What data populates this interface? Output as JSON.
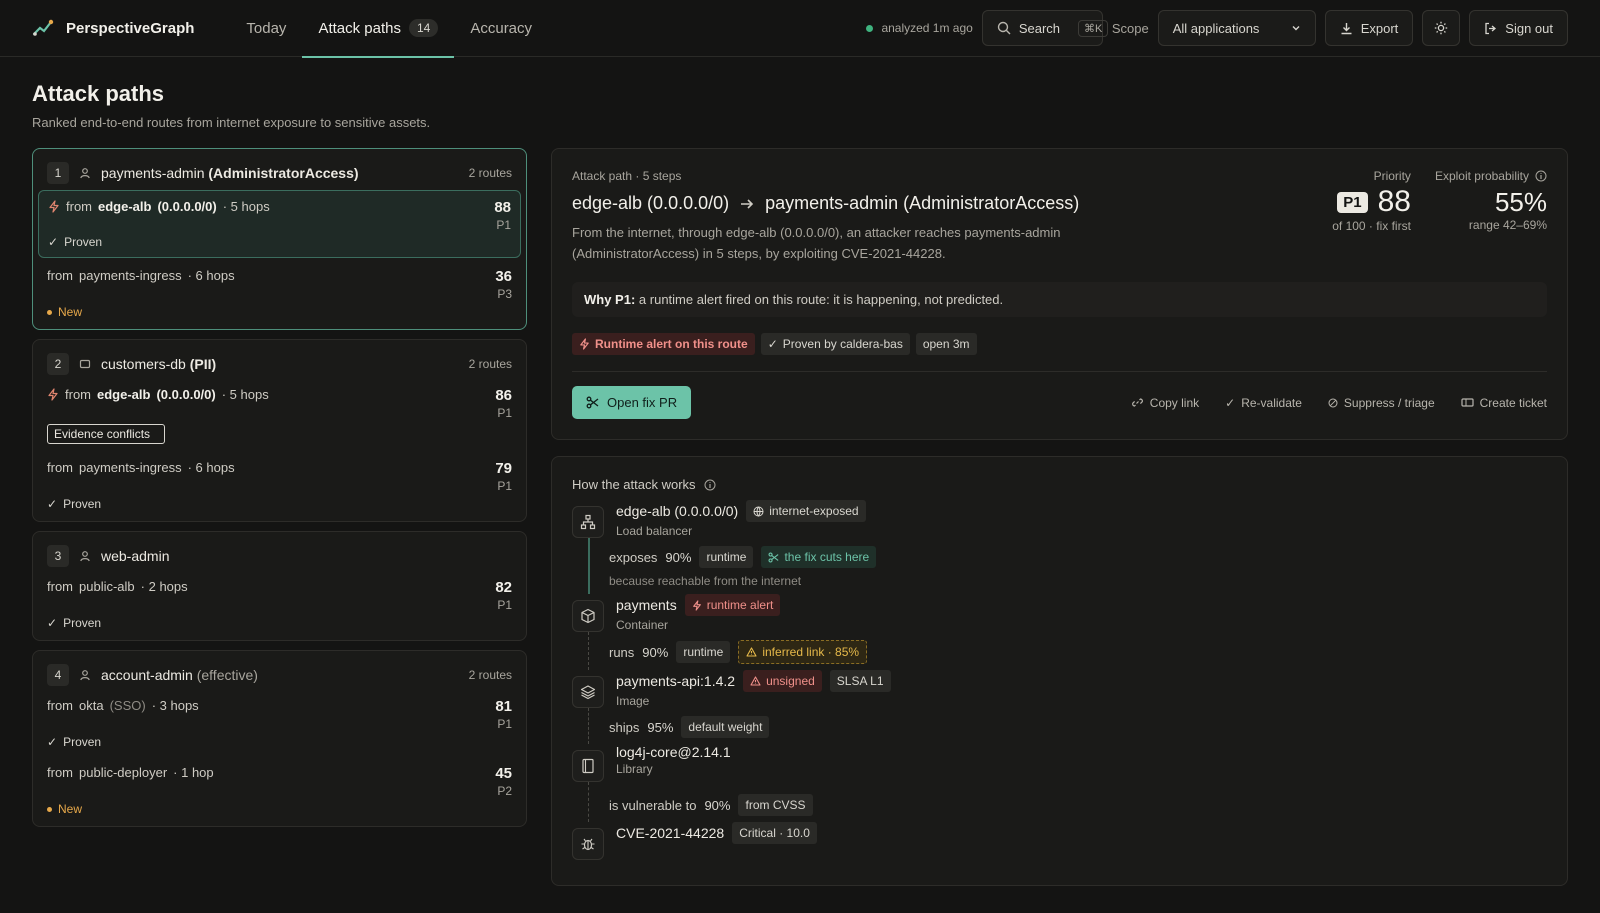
{
  "app": {
    "name": "PerspectiveGraph"
  },
  "nav": [
    {
      "label": "Today"
    },
    {
      "label": "Attack paths",
      "badge": "14"
    },
    {
      "label": "Accuracy"
    }
  ],
  "header": {
    "status": "analyzed 1m ago",
    "search_label": "Search",
    "search_shortcut": "⌘K",
    "scope_label": "Scope",
    "scope_value": "All applications",
    "export_label": "Export",
    "signout_label": "Sign out"
  },
  "page": {
    "title": "Attack paths",
    "subtitle": "Ranked end-to-end routes from internet exposure to sensitive assets."
  },
  "paths": [
    {
      "rank": "1",
      "name": "payments-admin",
      "qualifier": "(AdministratorAccess)",
      "routes": "2 routes",
      "items": [
        {
          "prefix": "from",
          "src": "edge-alb",
          "srcq": "(0.0.0.0/0)",
          "hops": "· 5 hops",
          "score": "88",
          "priority": "P1",
          "tag": "Proven"
        },
        {
          "prefix": "from",
          "src": "payments-ingress",
          "hops": "· 6 hops",
          "score": "36",
          "priority": "P3",
          "tag": "New"
        }
      ]
    },
    {
      "rank": "2",
      "name": "customers-db",
      "qualifier": "(PII)",
      "routes": "2 routes",
      "items": [
        {
          "prefix": "from",
          "src": "edge-alb",
          "srcq": "(0.0.0.0/0)",
          "hops": "· 5 hops",
          "score": "86",
          "priority": "P1",
          "tag": "Evidence conflicts"
        },
        {
          "prefix": "from",
          "src": "payments-ingress",
          "hops": "· 6 hops",
          "score": "79",
          "priority": "P1",
          "tag": "Proven"
        }
      ]
    },
    {
      "rank": "3",
      "name": "web-admin",
      "items": [
        {
          "prefix": "from",
          "src": "public-alb",
          "hops": "· 2 hops",
          "score": "82",
          "priority": "P1",
          "tag": "Proven"
        }
      ]
    },
    {
      "rank": "4",
      "name": "account-admin",
      "qualifier": "(effective)",
      "routes": "2 routes",
      "items": [
        {
          "prefix": "from",
          "src": "okta",
          "srcq": "(SSO)",
          "hops": "· 3 hops",
          "score": "81",
          "priority": "P1",
          "tag": "Proven"
        },
        {
          "prefix": "from",
          "src": "public-deployer",
          "hops": "· 1 hop",
          "score": "45",
          "priority": "P2",
          "tag": "New"
        }
      ]
    }
  ],
  "detail": {
    "eyebrow": "Attack path · 5 steps",
    "source": "edge-alb (0.0.0.0/0)",
    "target": "payments-admin (AdministratorAccess)",
    "description": "From the internet, through edge-alb (0.0.0.0/0), an attacker reaches payments-admin (AdministratorAccess) in 5 steps, by exploiting CVE-2021-44228.",
    "priority_label": "Priority",
    "priority_badge": "P1",
    "priority_score": "88",
    "priority_note": "of 100 · fix first",
    "exploit_label": "Exploit probability",
    "exploit_value": "55%",
    "exploit_range": "range 42–69%",
    "why_label": "Why P1:",
    "why_text": "a runtime alert fired on this route: it is happening, not predicted.",
    "chips": [
      "Runtime alert on this route",
      "Proven by caldera-bas",
      "open 3m"
    ],
    "primary_action": "Open fix PR",
    "actions": [
      "Copy link",
      "Re-validate",
      "Suppress / triage",
      "Create ticket"
    ]
  },
  "how": {
    "title": "How the attack works",
    "steps": [
      {
        "name": "edge-alb (0.0.0.0/0)",
        "type": "Load balancer",
        "icon": "network-icon",
        "chip": "internet-exposed",
        "edge": {
          "verb": "exposes",
          "pct": "90%",
          "chips": [
            "runtime",
            "the fix cuts here"
          ],
          "note": "because reachable from the internet"
        }
      },
      {
        "name": "payments",
        "type": "Container",
        "icon": "box-icon",
        "chip": "runtime alert",
        "edge": {
          "verb": "runs",
          "pct": "90%",
          "chips": [
            "runtime",
            "inferred link · 85%"
          ]
        }
      },
      {
        "name": "payments-api:1.4.2",
        "type": "Image",
        "icon": "layers-icon",
        "chip": "unsigned",
        "chip2": "SLSA L1",
        "edge": {
          "verb": "ships",
          "pct": "95%",
          "chips": [
            "default weight"
          ]
        }
      },
      {
        "name": "log4j-core@2.14.1",
        "type": "Library",
        "icon": "book-icon",
        "edge": {
          "verb": "is vulnerable to",
          "pct": "90%",
          "chips": [
            "from CVSS"
          ]
        }
      },
      {
        "name": "CVE-2021-44228",
        "icon": "bug-icon",
        "chip": "Critical · 10.0"
      }
    ]
  }
}
